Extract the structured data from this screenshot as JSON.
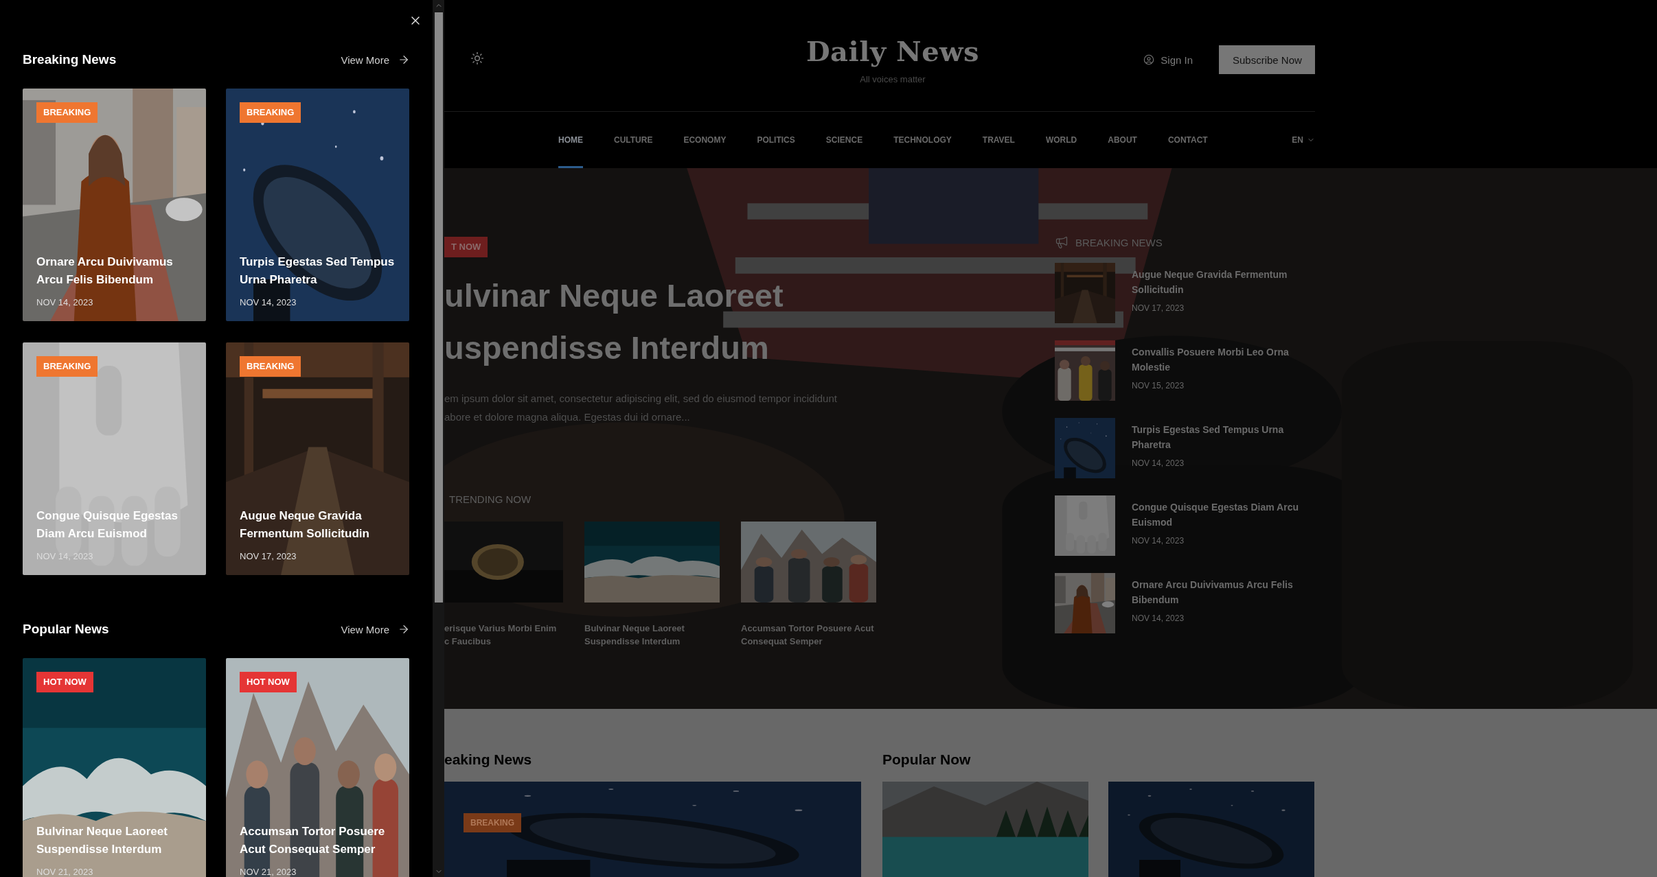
{
  "offcanvas": {
    "sections": [
      {
        "title": "Breaking News",
        "view_more": "View More",
        "cards": [
          {
            "kind": "breaking",
            "badge": "BREAKING",
            "title": "Ornare Arcu Duivivamus Arcu Felis Bibendum",
            "date": "NOV 14, 2023"
          },
          {
            "kind": "breaking",
            "badge": "BREAKING",
            "title": "Turpis Egestas Sed Tempus Urna Pharetra",
            "date": "NOV 14, 2023"
          },
          {
            "kind": "breaking",
            "badge": "BREAKING",
            "title": "Congue Quisque Egestas Diam Arcu Euismod",
            "date": "NOV 14, 2023"
          },
          {
            "kind": "breaking",
            "badge": "BREAKING",
            "title": "Augue Neque Gravida Fermentum Sollicitudin",
            "date": "NOV 17, 2023"
          }
        ]
      },
      {
        "title": "Popular News",
        "view_more": "View More",
        "cards": [
          {
            "kind": "hot",
            "badge": "HOT NOW",
            "title": "Bulvinar Neque Laoreet Suspendisse Interdum",
            "date": "NOV 21, 2023"
          },
          {
            "kind": "hot",
            "badge": "HOT NOW",
            "title": "Accumsan Tortor Posuere Acut Consequat Semper",
            "date": "NOV 21, 2023"
          }
        ]
      }
    ]
  },
  "header": {
    "site_title": "Daily News",
    "tagline": "All voices matter",
    "sign_in": "Sign In",
    "subscribe": "Subscribe Now"
  },
  "nav": {
    "items": [
      {
        "label": "HOME",
        "selected": true
      },
      {
        "label": "CULTURE",
        "selected": false
      },
      {
        "label": "ECONOMY",
        "selected": false
      },
      {
        "label": "POLITICS",
        "selected": false
      },
      {
        "label": "SCIENCE",
        "selected": false
      },
      {
        "label": "TECHNOLOGY",
        "selected": false
      },
      {
        "label": "TRAVEL",
        "selected": false
      },
      {
        "label": "WORLD",
        "selected": false
      },
      {
        "label": "ABOUT",
        "selected": false
      },
      {
        "label": "CONTACT",
        "selected": false
      }
    ],
    "language": "EN"
  },
  "hero": {
    "badge": "T NOW",
    "title_lines": [
      "ulvinar Neque Laoreet",
      "uspendisse Interdum"
    ],
    "excerpt_lines": [
      "em ipsum dolor sit amet, consectetur adipiscing elit, sed do eiusmod tempor incididunt",
      "abore et dolore magna aliqua. Egestas dui id ornare..."
    ],
    "trending_label": "TRENDING NOW",
    "trending": [
      {
        "title_lines": [
          "erisque Varius Morbi Enim",
          "c Faucibus"
        ]
      },
      {
        "title_lines": [
          "Bulvinar Neque Laoreet",
          "Suspendisse Interdum"
        ]
      },
      {
        "title_lines": [
          "Accumsan Tortor Posuere Acut",
          "Consequat Semper"
        ]
      }
    ]
  },
  "sidebar": {
    "heading": "BREAKING NEWS",
    "items": [
      {
        "title": "Augue Neque Gravida Fermentum Sollicitudin",
        "date": "NOV 17, 2023"
      },
      {
        "title": "Convallis Posuere Morbi Leo Orna Molestie",
        "date": "NOV 15, 2023"
      },
      {
        "title": "Turpis Egestas Sed Tempus Urna Pharetra",
        "date": "NOV 14, 2023"
      },
      {
        "title": "Congue Quisque Egestas Diam Arcu Euismod",
        "date": "NOV 14, 2023"
      },
      {
        "title": "Ornare Arcu Duivivamus Arcu Felis Bibendum",
        "date": "NOV 14, 2023"
      }
    ]
  },
  "lower": {
    "breaking_heading": "eaking News",
    "breaking_badge": "BREAKING",
    "popular_heading": "Popular Now"
  }
}
